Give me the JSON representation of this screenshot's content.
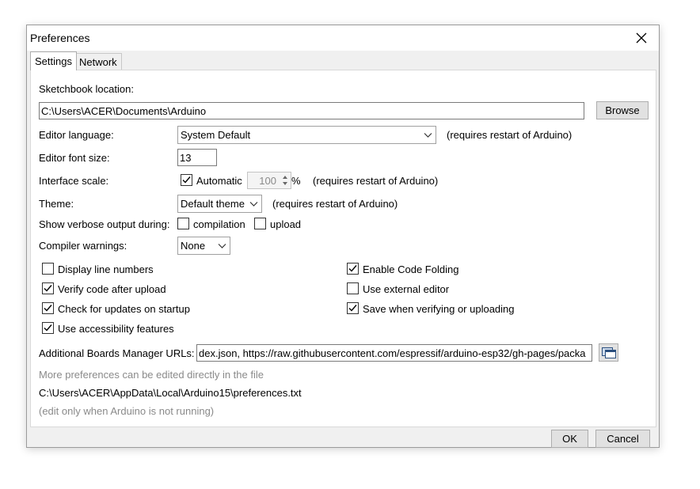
{
  "window": {
    "title": "Preferences"
  },
  "tabs": [
    {
      "label": "Settings",
      "active": true
    },
    {
      "label": "Network",
      "active": false
    }
  ],
  "sketchbook": {
    "label": "Sketchbook location:",
    "value": "C:\\Users\\ACER\\Documents\\Arduino",
    "browse_label": "Browse"
  },
  "editor_language": {
    "label": "Editor language:",
    "value": "System Default",
    "note": "(requires restart of Arduino)"
  },
  "font_size": {
    "label": "Editor font size:",
    "value": "13"
  },
  "interface_scale": {
    "label": "Interface scale:",
    "automatic_label": "Automatic",
    "automatic_checked": true,
    "value": "100",
    "unit": "%",
    "note": "(requires restart of Arduino)"
  },
  "theme": {
    "label": "Theme:",
    "value": "Default theme",
    "note": "(requires restart of Arduino)"
  },
  "verbose": {
    "label": "Show verbose output during:",
    "compilation_label": "compilation",
    "compilation_checked": false,
    "upload_label": "upload",
    "upload_checked": false
  },
  "compiler_warnings": {
    "label": "Compiler warnings:",
    "value": "None"
  },
  "options": {
    "display_line_numbers": {
      "label": "Display line numbers",
      "checked": false
    },
    "verify_after_upload": {
      "label": "Verify code after upload",
      "checked": true
    },
    "check_updates": {
      "label": "Check for updates on startup",
      "checked": true
    },
    "accessibility": {
      "label": "Use accessibility features",
      "checked": true
    },
    "code_folding": {
      "label": "Enable Code Folding",
      "checked": true
    },
    "external_editor": {
      "label": "Use external editor",
      "checked": false
    },
    "save_when_verifying": {
      "label": "Save when verifying or uploading",
      "checked": true
    }
  },
  "boards_urls": {
    "label": "Additional Boards Manager URLs:",
    "value": "dex.json, https://raw.githubusercontent.com/espressif/arduino-esp32/gh-pages/packa"
  },
  "more_prefs": {
    "note": "More preferences can be edited directly in the file",
    "path": "C:\\Users\\ACER\\AppData\\Local\\Arduino15\\preferences.txt",
    "edit_note": "(edit only when Arduino is not running)"
  },
  "footer": {
    "ok_label": "OK",
    "cancel_label": "Cancel"
  },
  "icons": {
    "close": "close-icon",
    "dropdown": "chevron-down-icon",
    "checkmark": "checkmark-icon",
    "spinner": "spinner-arrows-icon",
    "list_editor": "list-editor-icon"
  }
}
